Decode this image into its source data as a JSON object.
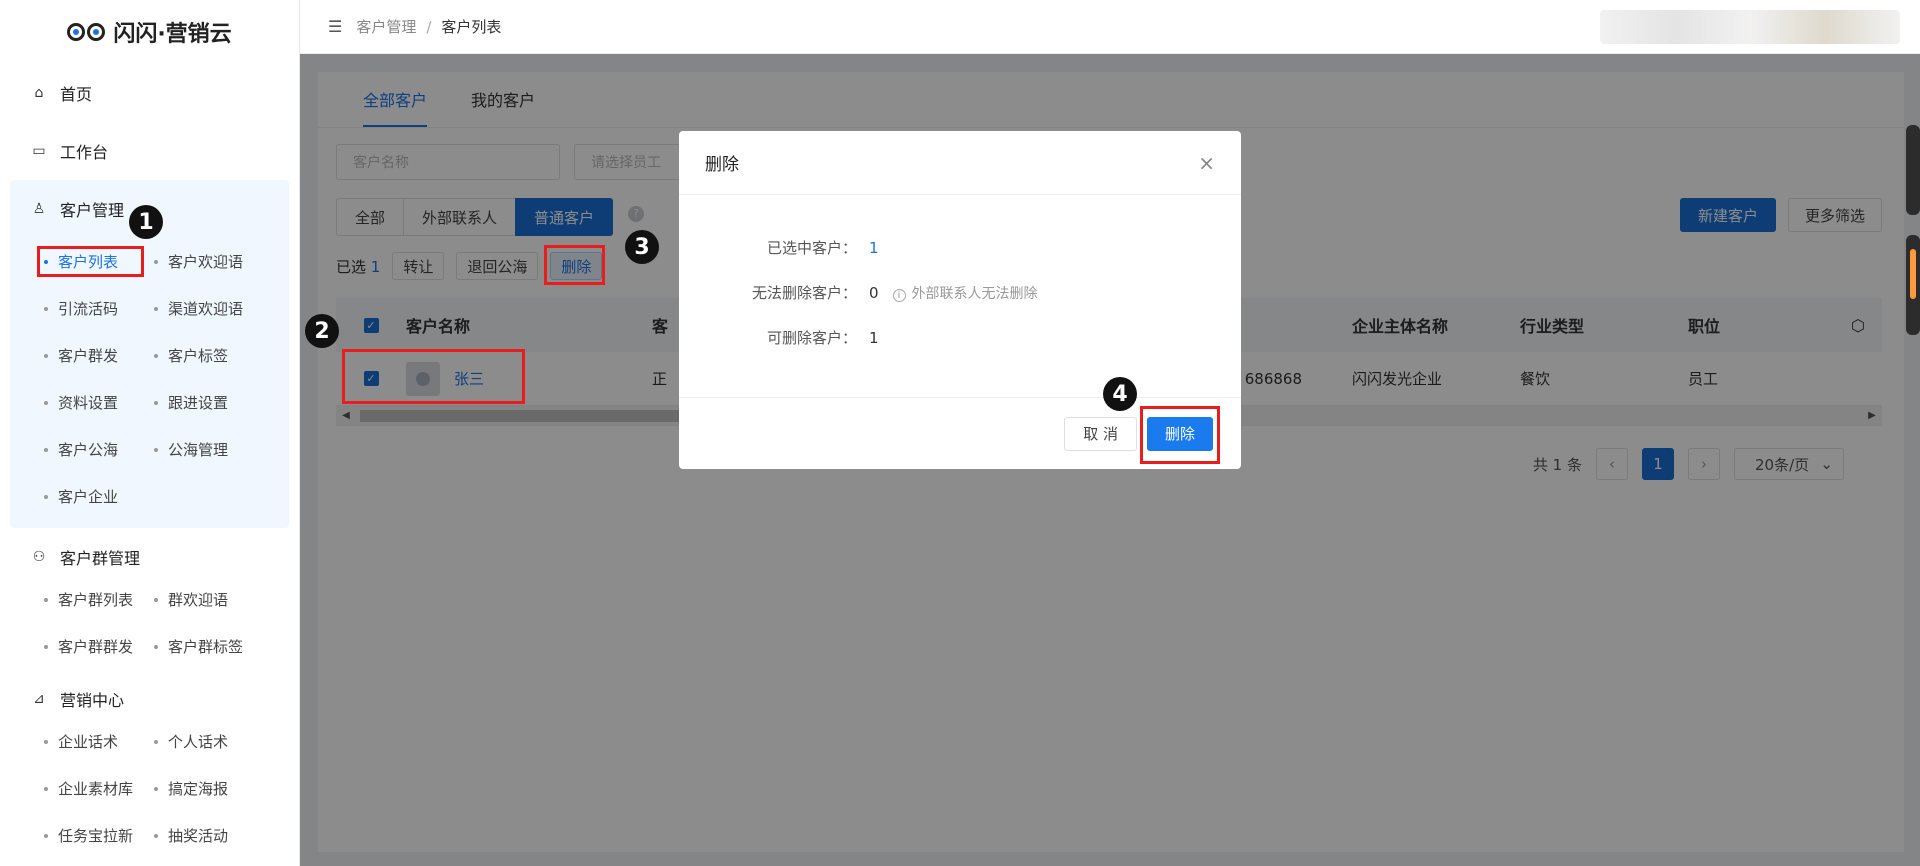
{
  "app": {
    "name": "闪闪·营销云"
  },
  "breadcrumb": {
    "parent": "客户管理",
    "sep": "/",
    "current": "客户列表"
  },
  "sidebar": {
    "home": "首页",
    "workbench": "工作台",
    "customer_mgmt": {
      "title": "客户管理",
      "items": [
        "客户列表",
        "客户欢迎语",
        "引流活码",
        "渠道欢迎语",
        "客户群发",
        "客户标签",
        "资料设置",
        "跟进设置",
        "客户公海",
        "公海管理",
        "客户企业"
      ]
    },
    "group_mgmt": {
      "title": "客户群管理",
      "items": [
        "客户群列表",
        "群欢迎语",
        "客户群群发",
        "客户群标签"
      ]
    },
    "marketing": {
      "title": "营销中心",
      "items": [
        "企业话术",
        "个人话术",
        "企业素材库",
        "搞定海报",
        "任务宝拉新",
        "抽奖活动"
      ]
    }
  },
  "tabs": [
    "全部客户",
    "我的客户"
  ],
  "filters": {
    "name_placeholder": "客户名称",
    "staff_placeholder": "请选择员工"
  },
  "segments": [
    "全部",
    "外部联系人",
    "普通客户"
  ],
  "help": "?",
  "actions": {
    "new_customer": "新建客户",
    "more_filter": "更多筛选"
  },
  "selection": {
    "label": "已选",
    "count": "1",
    "transfer": "转让",
    "return_pool": "退回公海",
    "delete": "删除"
  },
  "table": {
    "headers": [
      "客户名称",
      "客",
      "企业主体名称",
      "行业类型",
      "职位"
    ],
    "row": {
      "name": "张三",
      "col2": "正",
      "phone": "686868",
      "company": "闪闪发光企业",
      "industry": "餐饮",
      "position": "员工"
    }
  },
  "pager": {
    "total": "共 1 条",
    "page": "1",
    "size": "20条/页"
  },
  "modal": {
    "title": "删除",
    "rows": [
      {
        "label": "已选中客户：",
        "value": "1"
      },
      {
        "label": "无法删除客户：",
        "value": "0",
        "hint": "外部联系人无法删除"
      },
      {
        "label": "可删除客户：",
        "value": "1"
      }
    ],
    "cancel": "取 消",
    "confirm": "删除"
  },
  "badges": [
    "1",
    "2",
    "3",
    "4"
  ],
  "colors": {
    "primary": "#1a6fd6",
    "annotation": "#e81d1d"
  }
}
